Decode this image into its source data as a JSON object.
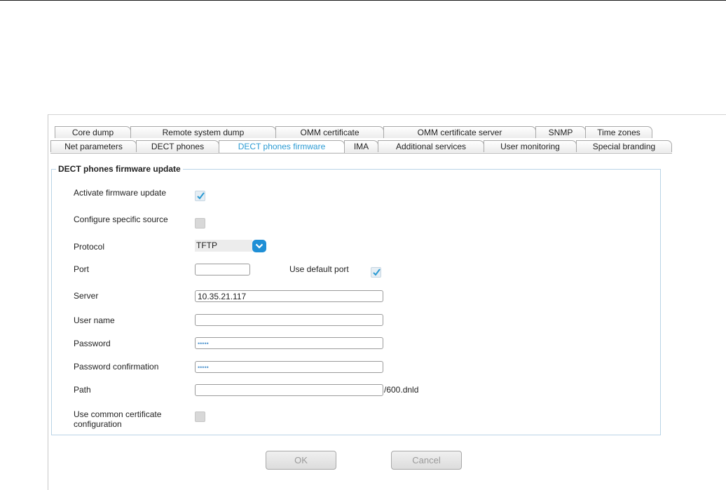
{
  "tabs_row1": [
    {
      "label": "Core dump"
    },
    {
      "label": "Remote system dump"
    },
    {
      "label": "OMM certificate"
    },
    {
      "label": "OMM certificate server"
    },
    {
      "label": "SNMP"
    },
    {
      "label": "Time zones"
    }
  ],
  "tabs_row2": [
    {
      "label": "Net parameters"
    },
    {
      "label": "DECT phones"
    },
    {
      "label": "DECT phones firmware",
      "active": true
    },
    {
      "label": "IMA"
    },
    {
      "label": "Additional services"
    },
    {
      "label": "User monitoring"
    },
    {
      "label": "Special branding"
    }
  ],
  "section": {
    "title": "DECT phones firmware update"
  },
  "form": {
    "activate_label": "Activate firmware update",
    "activate_checked": true,
    "specific_source_label": "Configure specific source",
    "specific_source_checked": false,
    "protocol_label": "Protocol",
    "protocol_value": "TFTP",
    "port_label": "Port",
    "port_value": "",
    "default_port_label": "Use default port",
    "default_port_checked": true,
    "server_label": "Server",
    "server_value": "10.35.21.117",
    "username_label": "User name",
    "username_value": "",
    "password_label": "Password",
    "password_value": "•••••",
    "password_confirm_label": "Password confirmation",
    "password_confirm_value": "•••••",
    "path_label": "Path",
    "path_value": "",
    "path_suffix": "/600.dnld",
    "common_cert_label_line1": "Use common certificate",
    "common_cert_label_line2": "configuration",
    "common_cert_checked": false
  },
  "buttons": {
    "ok": "OK",
    "cancel": "Cancel"
  },
  "colors": {
    "accent": "#2a9ad3",
    "select_button": "#1f8fd6",
    "fieldset_border": "#b8d3e6"
  },
  "icons": {
    "check": "check-icon",
    "dropdown": "chevron-down-icon"
  }
}
